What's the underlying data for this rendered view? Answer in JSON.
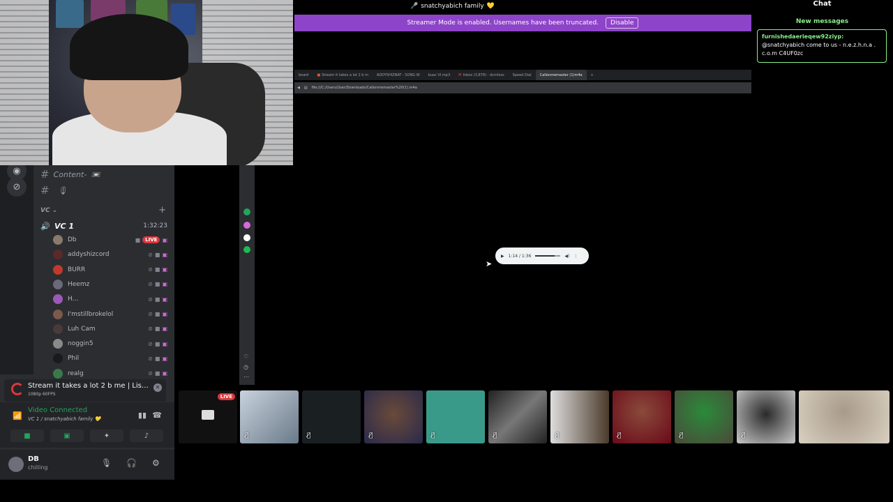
{
  "top": {
    "streamer_name": "snatchyabich family",
    "streamer_emoji": "💛",
    "banner_text": "Streamer Mode is enabled. Usernames have been truncated.",
    "disable_label": "Disable",
    "banner_color": "#8e44c9"
  },
  "browser": {
    "tabs": [
      "board",
      "Stream it takes a lot 2 b m",
      "ADDYSHIZNAT - SONG W",
      "buac VI.mp3",
      "Inbox (3,878) - dcrnloss",
      "Speed Dial",
      "Callonmemaster (1)m4a"
    ],
    "active_tab_index": 6,
    "address": "file:///C:/Users/User/Downloads/Callonmemaster%20(1).m4a"
  },
  "player": {
    "time_label": "1:14 / 1:36",
    "progress": 0.77
  },
  "chat": {
    "title": "Chat",
    "new_messages_label": "New messages",
    "message": {
      "user": "furnishedaerieqew92ziyp",
      "text": "@snatchyabich come to us - n.e.z.h.n.a . c.o.m C4UF0zc"
    }
  },
  "discord": {
    "channels": [
      {
        "name": "Content-",
        "emoji": "📼"
      },
      {
        "name": "",
        "emoji": "🎙"
      }
    ],
    "voice_category": "VC",
    "voice_channel": {
      "name": "VC 1",
      "elapsed": "1:32:23"
    },
    "members": [
      {
        "name": "Db",
        "live": true,
        "live_label": "LIVE",
        "color": "#8a7a6a"
      },
      {
        "name": "addyshizcord",
        "live": false,
        "color": "#5a2a2a"
      },
      {
        "name": "BURR",
        "live": false,
        "color": "#c0392b"
      },
      {
        "name": "Heemz",
        "live": false,
        "color": "#6a6a7a"
      },
      {
        "name": "H...",
        "live": false,
        "color": "#9b59b6"
      },
      {
        "name": "I'mstillbrokelol",
        "live": false,
        "color": "#7a5a4a"
      },
      {
        "name": "Luh Cam",
        "live": false,
        "color": "#4a3a3a"
      },
      {
        "name": "noggin5",
        "live": false,
        "color": "#8a8a8a"
      },
      {
        "name": "Phil",
        "live": false,
        "color": "#1a1a1a"
      },
      {
        "name": "realg",
        "live": false,
        "color": "#3a7a4a"
      }
    ],
    "stream_notification": {
      "title": "Stream it takes a lot 2 b me | Listen ...",
      "quality": "1080p 60FPS"
    },
    "rtc": {
      "status": "Video Connected",
      "location": "VC 1 / snatchyabich family 💛"
    },
    "user": {
      "name": "DB",
      "status": "chilling"
    }
  },
  "tiles": {
    "live_label": "LIVE"
  },
  "colors": {
    "discord_bg": "#2b2d31",
    "connected_green": "#23a55a",
    "live_red": "#da373c",
    "chat_accent": "#8bf08b"
  }
}
